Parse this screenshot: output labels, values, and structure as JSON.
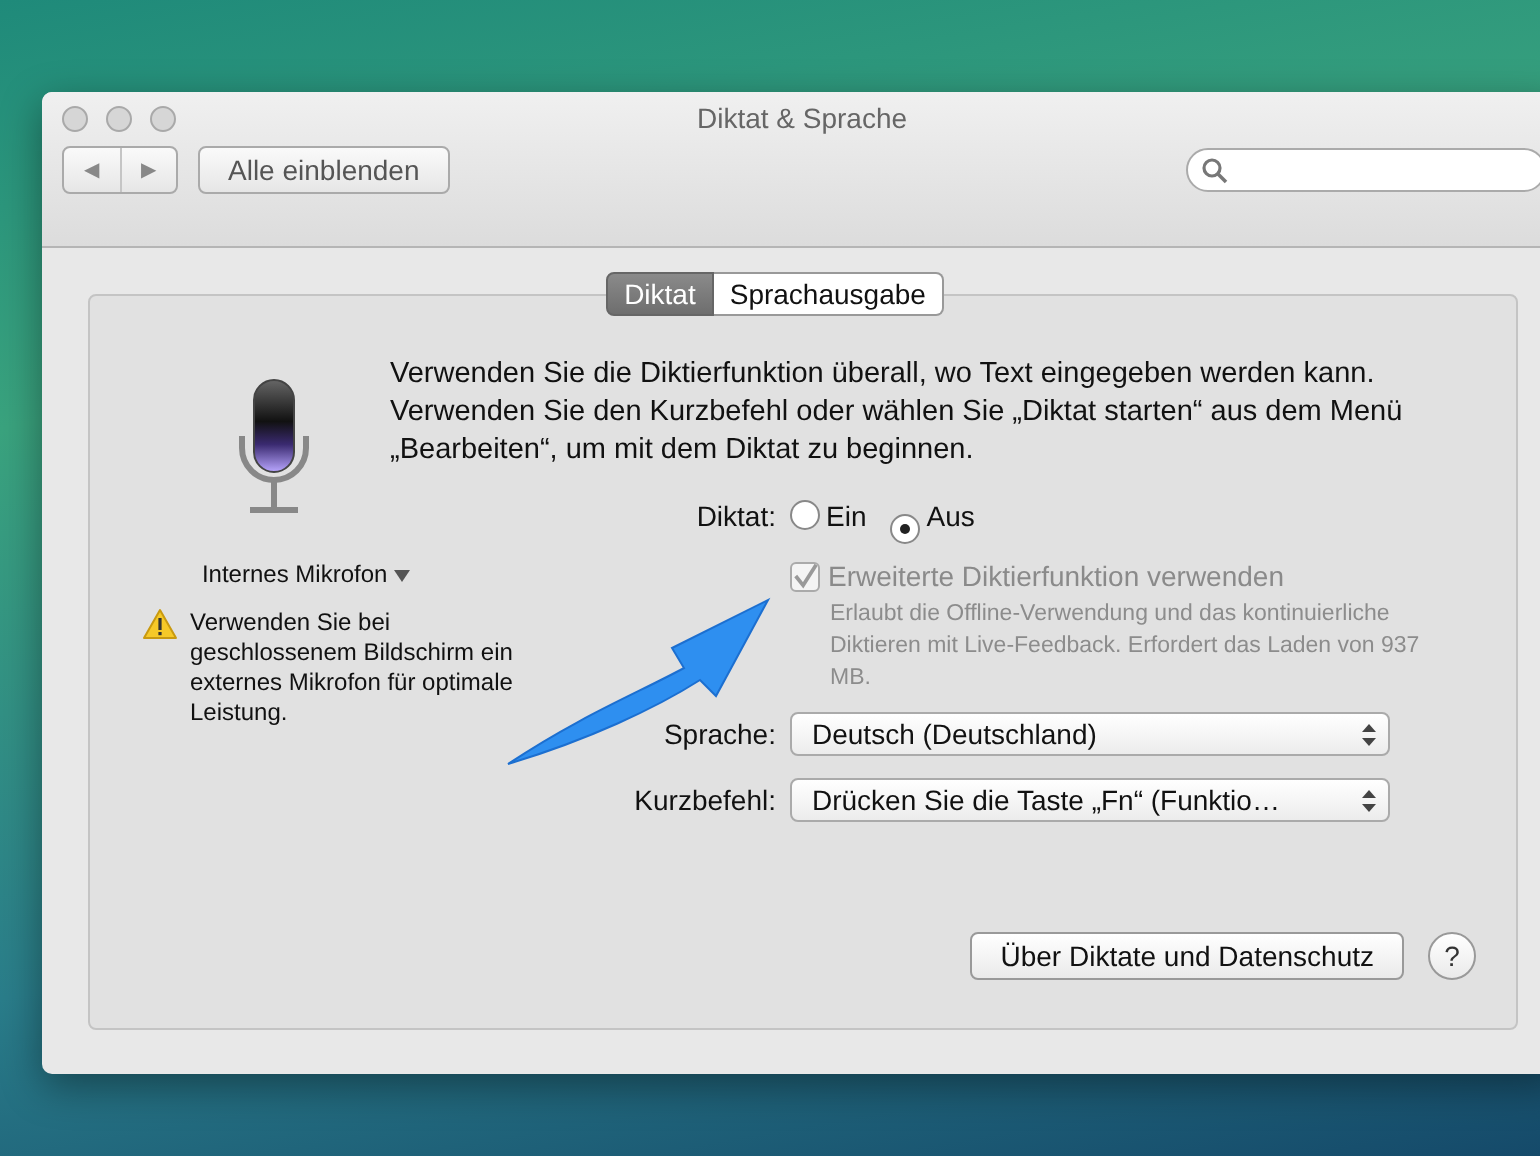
{
  "window": {
    "title": "Diktat & Sprache"
  },
  "toolbar": {
    "back": "◀",
    "forward": "▶",
    "show_all": "Alle einblenden"
  },
  "tabs": [
    {
      "label": "Diktat",
      "selected": true
    },
    {
      "label": "Sprachausgabe",
      "selected": false
    }
  ],
  "microphone": {
    "source": "Internes Mikrofon",
    "warning": "Verwenden Sie bei geschlossenem Bildschirm ein externes Mikrofon für optimale Leistung."
  },
  "description": "Verwenden Sie die Diktierfunktion überall, wo Text eingegeben werden kann. Verwenden Sie den Kurzbefehl oder wählen Sie „Diktat starten“ aus dem Menü „Bearbeiten“, um mit dem Diktat zu beginnen.",
  "dictation": {
    "label": "Diktat:",
    "options": [
      {
        "label": "Ein",
        "selected": false
      },
      {
        "label": "Aus",
        "selected": true
      }
    ]
  },
  "enhanced": {
    "label": "Erweiterte Diktierfunktion verwenden",
    "checked": true,
    "disabled": true,
    "description": "Erlaubt die Offline-Verwendung und das kontinuierliche Diktieren mit Live-Feedback. Erfordert das Laden von 937 MB."
  },
  "selects": [
    {
      "label": "Sprache:",
      "value": "Deutsch (Deutschland)"
    },
    {
      "label": "Kurzbefehl:",
      "value": "Drücken Sie die Taste „Fn“ (Funktio…"
    }
  ],
  "buttons": {
    "about": "Über Diktate und Datenschutz",
    "help": "?"
  }
}
